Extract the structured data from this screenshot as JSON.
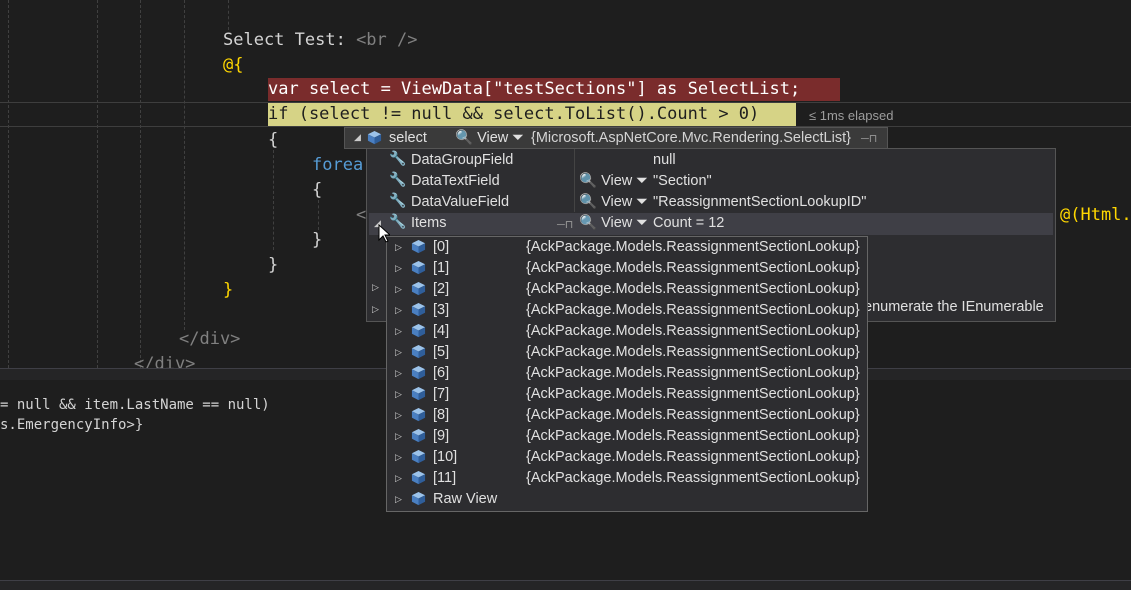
{
  "code": {
    "select_test_text": "Select Test: ",
    "br_tag": "<br />",
    "at_brace": "@{",
    "line_var": "var select = ViewData[\"testSections\"] as SelectList;",
    "line_if": "if (select != null && select.ToList().Count > 0)",
    "open_brace": "{",
    "close_brace": "}",
    "foreach_partial": "forea",
    "lt_partial": "<",
    "html_partial": "@(Html.",
    "close_div": "</div>",
    "close_div2": "</div>",
    "elapsed": "≤ 1ms elapsed"
  },
  "panel": {
    "line1": "= null && item.LastName == null)",
    "line2": "s.EmergencyInfo>}"
  },
  "datatip": {
    "variable": "select",
    "view_label": "View",
    "type": "{Microsoft.AspNetCore.Mvc.Rendering.SelectList}",
    "properties": [
      {
        "name": "DataGroupField",
        "value": "null",
        "has_view": false
      },
      {
        "name": "DataTextField",
        "value": "\"Section\"",
        "has_view": true
      },
      {
        "name": "DataValueField",
        "value": "\"ReassignmentSectionLookupID\"",
        "has_view": true
      },
      {
        "name": "Items",
        "value": "Count = 12",
        "has_view": true
      }
    ],
    "hidden_row_tail": "enumerate the IEnumerable",
    "items": [
      {
        "index": "[0]",
        "value": "{AckPackage.Models.ReassignmentSectionLookup}"
      },
      {
        "index": "[1]",
        "value": "{AckPackage.Models.ReassignmentSectionLookup}"
      },
      {
        "index": "[2]",
        "value": "{AckPackage.Models.ReassignmentSectionLookup}"
      },
      {
        "index": "[3]",
        "value": "{AckPackage.Models.ReassignmentSectionLookup}"
      },
      {
        "index": "[4]",
        "value": "{AckPackage.Models.ReassignmentSectionLookup}"
      },
      {
        "index": "[5]",
        "value": "{AckPackage.Models.ReassignmentSectionLookup}"
      },
      {
        "index": "[6]",
        "value": "{AckPackage.Models.ReassignmentSectionLookup}"
      },
      {
        "index": "[7]",
        "value": "{AckPackage.Models.ReassignmentSectionLookup}"
      },
      {
        "index": "[8]",
        "value": "{AckPackage.Models.ReassignmentSectionLookup}"
      },
      {
        "index": "[9]",
        "value": "{AckPackage.Models.ReassignmentSectionLookup}"
      },
      {
        "index": "[10]",
        "value": "{AckPackage.Models.ReassignmentSectionLookup}"
      },
      {
        "index": "[11]",
        "value": "{AckPackage.Models.ReassignmentSectionLookup}"
      }
    ],
    "raw_view": "Raw View"
  }
}
